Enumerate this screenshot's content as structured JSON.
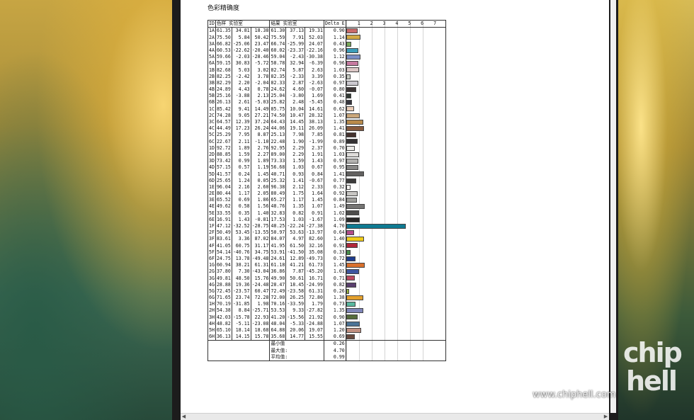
{
  "title": "色彩精确度",
  "header": {
    "id": "ID",
    "lab1": "色样 实验室",
    "lab2": "结果 实验室",
    "de": "Delta E",
    "scale": [
      "1",
      "2",
      "3",
      "4",
      "5",
      "6",
      "7"
    ]
  },
  "rows": [
    {
      "id": "1A",
      "l": "61.35",
      "a": "34.81",
      "b": "18.38",
      "l2": "61.30",
      "a2": "37.13",
      "b2": "19.31",
      "de": "0.90",
      "color": "#c96a6a"
    },
    {
      "id": "2A",
      "l": "75.50",
      "a": "5.84",
      "b": "50.42",
      "l2": "75.59",
      "a2": "7.91",
      "b2": "52.03",
      "de": "1.14",
      "color": "#d2a944"
    },
    {
      "id": "3A",
      "l": "66.82",
      "a": "-25.06",
      "b": "23.47",
      "l2": "66.74",
      "a2": "-25.99",
      "b2": "24.07",
      "de": "0.43",
      "color": "#7aaa58"
    },
    {
      "id": "4A",
      "l": "60.53",
      "a": "-22.62",
      "b": "-20.40",
      "l2": "60.02",
      "a2": "-23.37",
      "b2": "-22.16",
      "de": "0.96",
      "color": "#3b9dba"
    },
    {
      "id": "5A",
      "l": "59.66",
      "a": "-2.03",
      "b": "-28.46",
      "l2": "59.04",
      "a2": "-2.43",
      "b2": "-30.38",
      "de": "1.12",
      "color": "#7a8ec6"
    },
    {
      "id": "6A",
      "l": "59.15",
      "a": "30.83",
      "b": "-5.72",
      "l2": "58.78",
      "a2": "32.94",
      "b2": "-6.39",
      "de": "0.96",
      "color": "#c67aa0"
    },
    {
      "id": "1B",
      "l": "82.68",
      "a": "5.03",
      "b": "3.02",
      "l2": "82.74",
      "a2": "5.87",
      "b2": "2.63",
      "de": "1.03",
      "color": "#dcc7c6"
    },
    {
      "id": "2B",
      "l": "82.25",
      "a": "-2.42",
      "b": "3.78",
      "l2": "82.35",
      "a2": "-2.33",
      "b2": "3.39",
      "de": "0.35",
      "color": "#c8ccc3"
    },
    {
      "id": "3B",
      "l": "82.29",
      "a": "2.20",
      "b": "-2.04",
      "l2": "82.33",
      "a2": "2.87",
      "b2": "-2.63",
      "de": "0.97",
      "color": "#cbc8cf"
    },
    {
      "id": "4B",
      "l": "24.89",
      "a": "4.43",
      "b": "0.78",
      "l2": "24.62",
      "a2": "4.60",
      "b2": "-0.07",
      "de": "0.80",
      "color": "#3d3535"
    },
    {
      "id": "5B",
      "l": "25.16",
      "a": "-3.88",
      "b": "2.13",
      "l2": "25.04",
      "a2": "-3.80",
      "b2": "1.69",
      "de": "0.41",
      "color": "#323a34"
    },
    {
      "id": "6B",
      "l": "26.13",
      "a": "2.61",
      "b": "-5.03",
      "l2": "25.82",
      "a2": "2.48",
      "b2": "-5.45",
      "de": "0.48",
      "color": "#36363f"
    },
    {
      "id": "1C",
      "l": "85.42",
      "a": "9.41",
      "b": "14.49",
      "l2": "85.75",
      "a2": "10.04",
      "b2": "14.61",
      "de": "0.62",
      "color": "#e9ccb6"
    },
    {
      "id": "2C",
      "l": "74.28",
      "a": "9.05",
      "b": "27.21",
      "l2": "74.50",
      "a2": "10.47",
      "b2": "28.32",
      "de": "1.07",
      "color": "#c9a67a"
    },
    {
      "id": "3C",
      "l": "64.57",
      "a": "12.39",
      "b": "37.24",
      "l2": "64.43",
      "a2": "14.45",
      "b2": "38.13",
      "de": "1.35",
      "color": "#b98b4c"
    },
    {
      "id": "4C",
      "l": "44.49",
      "a": "17.23",
      "b": "26.24",
      "l2": "44.06",
      "a2": "19.11",
      "b2": "26.09",
      "de": "1.41",
      "color": "#875a3d"
    },
    {
      "id": "5C",
      "l": "25.29",
      "a": "7.95",
      "b": "8.87",
      "l2": "25.13",
      "a2": "7.98",
      "b2": "7.85",
      "de": "0.81",
      "color": "#45322e"
    },
    {
      "id": "6C",
      "l": "22.67",
      "a": "2.11",
      "b": "-1.10",
      "l2": "22.48",
      "a2": "1.90",
      "b2": "-1.99",
      "de": "0.89",
      "color": "#353234"
    },
    {
      "id": "1D",
      "l": "92.72",
      "a": "1.89",
      "b": "2.76",
      "l2": "92.95",
      "a2": "2.29",
      "b2": "2.37",
      "de": "0.70",
      "color": "#ecebe8"
    },
    {
      "id": "2D",
      "l": "88.85",
      "a": "1.59",
      "b": "2.27",
      "l2": "89.00",
      "a2": "2.29",
      "b2": "1.91",
      "de": "1.03",
      "color": "#dedcda"
    },
    {
      "id": "3D",
      "l": "73.42",
      "a": "0.99",
      "b": "1.89",
      "l2": "73.33",
      "a2": "1.59",
      "b2": "1.43",
      "de": "0.97",
      "color": "#b2b1af"
    },
    {
      "id": "4D",
      "l": "57.15",
      "a": "0.57",
      "b": "1.19",
      "l2": "56.68",
      "a2": "1.03",
      "b2": "0.67",
      "de": "0.95",
      "color": "#888786"
    },
    {
      "id": "5D",
      "l": "41.57",
      "a": "0.24",
      "b": "1.45",
      "l2": "40.71",
      "a2": "0.93",
      "b2": "0.84",
      "de": "1.41",
      "color": "#626160"
    },
    {
      "id": "6D",
      "l": "25.65",
      "a": "1.24",
      "b": "0.05",
      "l2": "25.32",
      "a2": "1.41",
      "b2": "-0.67",
      "de": "0.77",
      "color": "#3c3b3b"
    },
    {
      "id": "1E",
      "l": "96.04",
      "a": "2.16",
      "b": "2.60",
      "l2": "96.38",
      "a2": "2.12",
      "b2": "2.33",
      "de": "0.32",
      "color": "#f7f4f1"
    },
    {
      "id": "2E",
      "l": "80.44",
      "a": "1.17",
      "b": "2.05",
      "l2": "80.49",
      "a2": "1.75",
      "b2": "1.64",
      "de": "0.92",
      "color": "#c8c6c3"
    },
    {
      "id": "3E",
      "l": "65.52",
      "a": "0.69",
      "b": "1.86",
      "l2": "65.27",
      "a2": "1.17",
      "b2": "1.45",
      "de": "0.84",
      "color": "#9e9d9a"
    },
    {
      "id": "4E",
      "l": "49.62",
      "a": "0.58",
      "b": "1.56",
      "l2": "48.76",
      "a2": "1.35",
      "b2": "1.07",
      "de": "1.49",
      "color": "#767574"
    },
    {
      "id": "5E",
      "l": "33.55",
      "a": "0.35",
      "b": "1.40",
      "l2": "32.83",
      "a2": "0.82",
      "b2": "0.91",
      "de": "1.02",
      "color": "#4e4d4c"
    },
    {
      "id": "6E",
      "l": "16.91",
      "a": "1.43",
      "b": "-0.81",
      "l2": "17.53",
      "a2": "1.03",
      "b2": "-1.67",
      "de": "1.09",
      "color": "#2a2828"
    },
    {
      "id": "1F",
      "l": "47.12",
      "a": "-32.52",
      "b": "-28.75",
      "l2": "48.25",
      "a2": "-22.24",
      "b2": "-27.38",
      "de": "4.70",
      "color": "#0e7a92"
    },
    {
      "id": "2F",
      "l": "50.49",
      "a": "53.45",
      "b": "-13.55",
      "l2": "50.97",
      "a2": "53.63",
      "b2": "-13.97",
      "de": "0.64",
      "color": "#b24d8a"
    },
    {
      "id": "3F",
      "l": "83.61",
      "a": "3.36",
      "b": "87.02",
      "l2": "84.07",
      "a2": "4.97",
      "b2": "82.60",
      "de": "1.40",
      "color": "#efcb1a"
    },
    {
      "id": "4F",
      "l": "41.05",
      "a": "60.75",
      "b": "31.17",
      "l2": "41.95",
      "a2": "61.50",
      "b2": "32.16",
      "de": "0.91",
      "color": "#b1273a"
    },
    {
      "id": "5F",
      "l": "54.14",
      "a": "-40.76",
      "b": "34.75",
      "l2": "53.91",
      "a2": "-41.50",
      "b2": "35.08",
      "de": "0.33",
      "color": "#47904a"
    },
    {
      "id": "6F",
      "l": "24.75",
      "a": "13.78",
      "b": "-49.48",
      "l2": "24.61",
      "a2": "12.89",
      "b2": "-49.73",
      "de": "0.72",
      "color": "#1f3b8d"
    },
    {
      "id": "1G",
      "l": "60.94",
      "a": "38.21",
      "b": "61.31",
      "l2": "61.18",
      "a2": "41.21",
      "b2": "61.73",
      "de": "1.45",
      "color": "#d9702c"
    },
    {
      "id": "2G",
      "l": "37.80",
      "a": "7.30",
      "b": "-43.04",
      "l2": "36.86",
      "a2": "7.87",
      "b2": "-45.20",
      "de": "1.01",
      "color": "#3d56a0"
    },
    {
      "id": "3G",
      "l": "49.81",
      "a": "48.50",
      "b": "15.76",
      "l2": "49.90",
      "a2": "50.61",
      "b2": "16.71",
      "de": "0.71",
      "color": "#bc4a60"
    },
    {
      "id": "4G",
      "l": "28.88",
      "a": "19.36",
      "b": "-24.48",
      "l2": "28.47",
      "a2": "18.45",
      "b2": "-24.99",
      "de": "0.82",
      "color": "#5a3f6e"
    },
    {
      "id": "5G",
      "l": "72.45",
      "a": "-23.57",
      "b": "60.47",
      "l2": "72.49",
      "a2": "-23.58",
      "b2": "61.31",
      "de": "0.26",
      "color": "#9cba3e"
    },
    {
      "id": "6G",
      "l": "71.65",
      "a": "23.74",
      "b": "72.28",
      "l2": "72.00",
      "a2": "26.25",
      "b2": "72.80",
      "de": "1.38",
      "color": "#e3a02d"
    },
    {
      "id": "1H",
      "l": "70.19",
      "a": "-31.85",
      "b": "1.98",
      "l2": "70.16",
      "a2": "-33.59",
      "b2": "1.79",
      "de": "0.73",
      "color": "#59b79f"
    },
    {
      "id": "2H",
      "l": "54.38",
      "a": "8.84",
      "b": "-25.71",
      "l2": "53.53",
      "a2": "9.33",
      "b2": "-27.82",
      "de": "1.35",
      "color": "#7f85b9"
    },
    {
      "id": "3H",
      "l": "42.03",
      "a": "-15.78",
      "b": "22.93",
      "l2": "41.20",
      "a2": "-15.56",
      "b2": "21.92",
      "de": "0.90",
      "color": "#566c3b"
    },
    {
      "id": "4H",
      "l": "48.82",
      "a": "-5.11",
      "b": "-23.08",
      "l2": "48.04",
      "a2": "-5.33",
      "b2": "-24.88",
      "de": "1.07",
      "color": "#4c7497"
    },
    {
      "id": "5H",
      "l": "65.10",
      "a": "18.14",
      "b": "18.68",
      "l2": "64.88",
      "a2": "20.06",
      "b2": "19.07",
      "de": "1.20",
      "color": "#c18f80"
    },
    {
      "id": "6H",
      "l": "36.13",
      "a": "14.15",
      "b": "15.78",
      "l2": "35.68",
      "a2": "14.77",
      "b2": "15.55",
      "de": "0.69",
      "color": "#6b4b3e"
    }
  ],
  "summary": [
    {
      "label": "最小值",
      "value": "0.26"
    },
    {
      "label": "最大值:",
      "value": "4.70"
    },
    {
      "label": "平均值:",
      "value": "0.99"
    }
  ],
  "watermark": "www.chiphell.com",
  "logo": "chip hell"
}
